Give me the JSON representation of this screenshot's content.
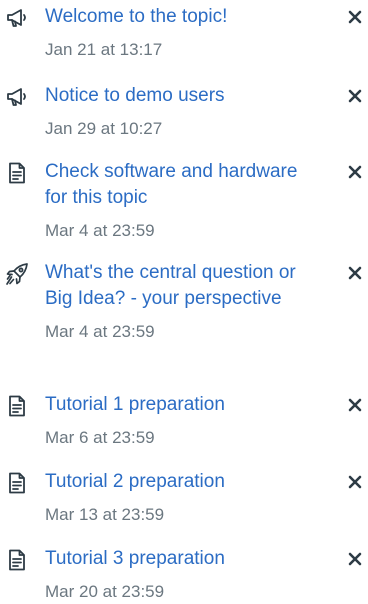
{
  "todo": {
    "items": [
      {
        "icon": "announcement-icon",
        "title": "Welcome to the topic!",
        "date": "Jan 21 at 13:17"
      },
      {
        "icon": "announcement-icon",
        "title": "Notice to demo users",
        "date": "Jan 29 at 10:27"
      },
      {
        "icon": "assignment-icon",
        "title": "Check software and hardware for this topic",
        "date": "Mar 4 at 23:59"
      },
      {
        "icon": "discussion-icon",
        "title": "What's the central question or Big Idea? - your perspective",
        "date": "Mar 4 at 23:59"
      },
      {
        "icon": "assignment-icon",
        "title": "Tutorial 1 preparation",
        "date": "Mar 6 at 23:59"
      },
      {
        "icon": "assignment-icon",
        "title": "Tutorial 2 preparation",
        "date": "Mar 13 at 23:59"
      },
      {
        "icon": "assignment-icon",
        "title": "Tutorial 3 preparation",
        "date": "Mar 20 at 23:59"
      }
    ],
    "dismiss_icon": "close-icon"
  },
  "colors": {
    "link": "#2b6cc4",
    "date": "#6b7780",
    "icon": "#2d3b45"
  }
}
